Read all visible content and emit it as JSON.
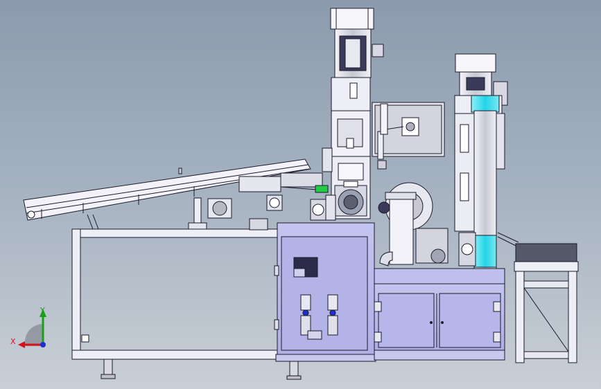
{
  "axes": {
    "x_label": "X",
    "y_label": "Y",
    "x_color": "#d8121a",
    "y_color": "#18a018",
    "z_color": "#1a2fd0"
  },
  "colors": {
    "background_top": "#8b9bad",
    "background_bottom": "#c9cfd6",
    "cabinet": "#b6b6ea",
    "frame": "#ececf6",
    "outline": "#1a1a2a",
    "cyan_tube": "#33d8e8",
    "green_part": "#22cc44"
  },
  "icons": {
    "triad": "xyz-triad-icon"
  }
}
